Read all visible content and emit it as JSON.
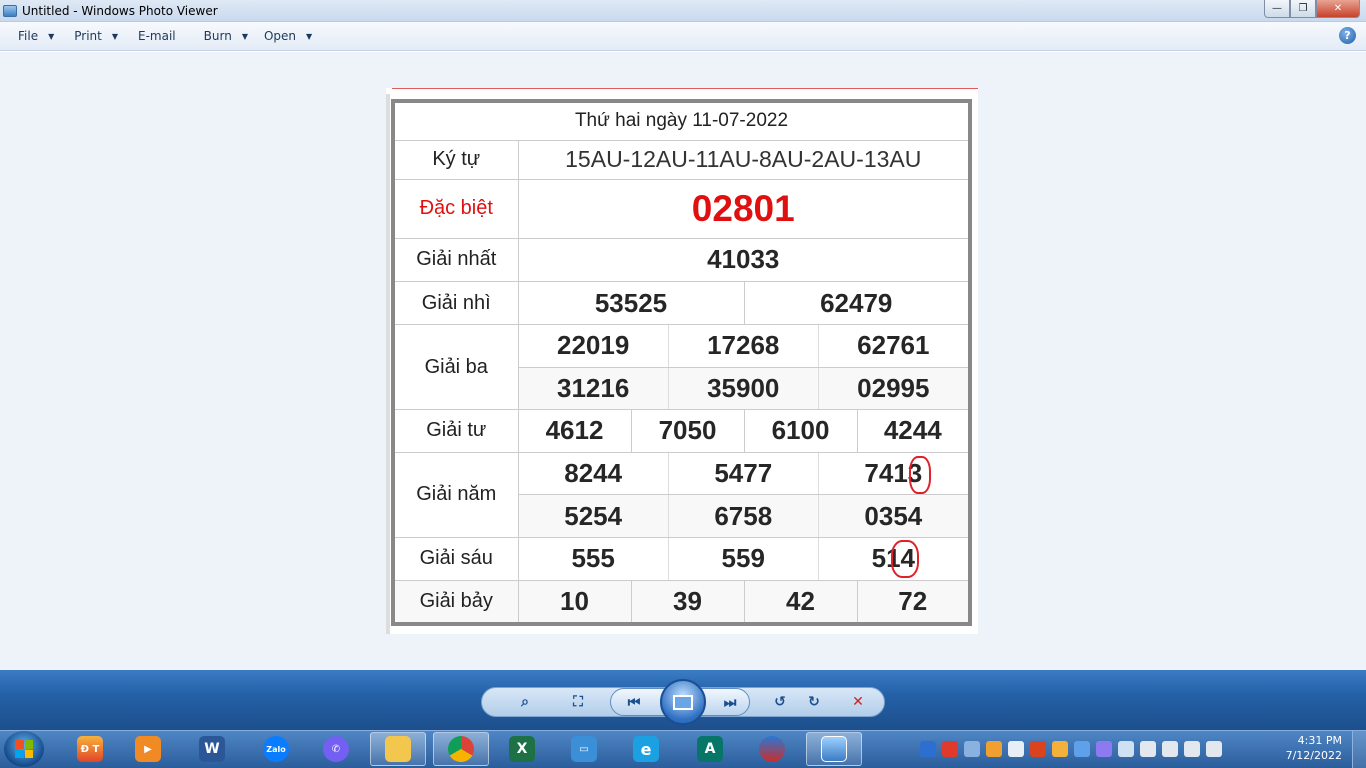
{
  "window": {
    "title": "Untitled - Windows Photo Viewer",
    "controls": {
      "minimize": "—",
      "maximize": "❐",
      "close": "✕"
    }
  },
  "menu": {
    "items": [
      {
        "label": "File",
        "has_dropdown": true
      },
      {
        "label": "Print",
        "has_dropdown": true
      },
      {
        "label": "E-mail",
        "has_dropdown": false
      },
      {
        "label": "Burn",
        "has_dropdown": true
      },
      {
        "label": "Open",
        "has_dropdown": true
      }
    ],
    "help": "?"
  },
  "lottery": {
    "header": "Thứ hai ngày 11-07-2022",
    "kytu": {
      "label": "Ký tự",
      "value": "15AU-12AU-11AU-8AU-2AU-13AU"
    },
    "dacbiet": {
      "label": "Đặc biệt",
      "value": "02801"
    },
    "giainhat": {
      "label": "Giải nhất",
      "values": [
        "41033"
      ]
    },
    "giainhi": {
      "label": "Giải nhì",
      "values": [
        "53525",
        "62479"
      ]
    },
    "giaiba": {
      "label": "Giải ba",
      "values": [
        "22019",
        "17268",
        "62761",
        "31216",
        "35900",
        "02995"
      ]
    },
    "giaitu": {
      "label": "Giải tư",
      "values": [
        "4612",
        "7050",
        "6100",
        "4244"
      ]
    },
    "giainam": {
      "label": "Giải năm",
      "values": [
        "8244",
        "5477",
        "7413",
        "5254",
        "6758",
        "0354"
      ]
    },
    "giaisau": {
      "label": "Giải sáu",
      "values": [
        "555",
        "559",
        "514"
      ]
    },
    "giaibay": {
      "label": "Giải bảy",
      "values": [
        "10",
        "39",
        "42",
        "72"
      ]
    }
  },
  "viewer_controls": {
    "zoom": "⌕",
    "actual_size": "⛶",
    "previous": "⏮",
    "next": "⏭",
    "rotate_left": "↺",
    "rotate_right": "↻",
    "delete": "✕"
  },
  "taskbar": {
    "apps": [
      "Đ T",
      "Word",
      "Zalo",
      "Viber",
      "Explorer",
      "Chrome",
      "Excel",
      "Remote",
      "IE",
      "Publisher",
      "Edge",
      "Photo Viewer"
    ],
    "clock_time": "4:31 PM",
    "clock_date": "7/12/2022",
    "accent": "#2b5d9b"
  }
}
